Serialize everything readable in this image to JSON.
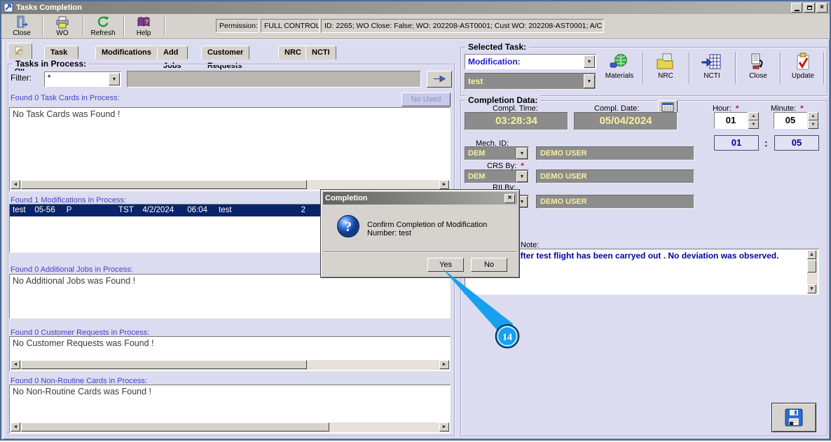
{
  "window": {
    "title": "Tasks Completion"
  },
  "toolbar": {
    "close": "Close",
    "wo": "WO",
    "refresh": "Refresh",
    "help": "Help",
    "permission_label": "Permission:",
    "permission_value": "FULL CONTROL",
    "context": "ID: 2265; WO Close: False; WO: 202208-AST0001; Cust WO: 202208-AST0001; A/C Reg:"
  },
  "tabs": [
    "All",
    "Task Cards",
    "Modifications",
    "Add Jobs",
    "Customer Requests",
    "NRC",
    "NCTI"
  ],
  "left": {
    "group_title": "Tasks in Process:",
    "filter_label": "Filter:",
    "filter_value": "*",
    "no_used_label": "No Used",
    "sections": [
      {
        "label": "Found 0 Task Cards in Process:",
        "content": "No Task Cards was Found !"
      },
      {
        "label": "Found 1 Modifications in Process:",
        "row": "test    05-56     P                     TST    4/2/2024      06:04     test                               2       1"
      },
      {
        "label": "Found 0 Additional Jobs in Process:",
        "content": "No Additional Jobs was Found !"
      },
      {
        "label": "Found 0 Customer Requests in Process:",
        "content": "No Customer Requests was Found !"
      },
      {
        "label": "Found 0 Non-Routine Cards in Process:",
        "content": "No Non-Routine Cards was Found !"
      }
    ]
  },
  "selected_task": {
    "group_title": "Selected Task:",
    "type_value": "Modification:",
    "task_value": "test",
    "buttons": [
      "Materials",
      "NRC",
      "NCTI",
      "Close",
      "Update"
    ]
  },
  "completion": {
    "group_title": "Completion Data:",
    "time_label": "Compl. Time:",
    "time_value": "03:28:34",
    "date_label": "Compl. Date:",
    "date_value": "05/04/2024",
    "hour_label": "Hour:",
    "hour_value": "01",
    "minute_label": "Minute:",
    "minute_value": "05",
    "hour_echo": "01",
    "minute_echo": "05",
    "colon": ":",
    "required_marker": "*",
    "mech_label": "Mech. ID:",
    "mech_value": "DEM",
    "mech_name": "DEMO USER",
    "crs_label": "CRS By:",
    "crs_value": "DEM",
    "crs_name": "DEMO USER",
    "rii_label": "RII By:",
    "rii_name": "DEMO USER",
    "note_label": "Note:",
    "note_text": "After test flight has been carryed out . No deviation was observed."
  },
  "dialog": {
    "title": "Completion",
    "message": "Confirm Completion of Modification Number: test",
    "yes_label": "Yes",
    "no_label": "No"
  },
  "callout": {
    "number": "14"
  },
  "icons": {
    "dropdown": "▼",
    "scroll_left": "◄",
    "scroll_right": "►",
    "scroll_up": "▲",
    "scroll_down": "▼",
    "spin_up": "▲",
    "spin_down": "▼",
    "close_x": "×"
  },
  "colors": {
    "selection_navy": "#0a246a",
    "panel_lavender": "#dcdcf0",
    "field_gray": "#8c8c8c",
    "value_yellow": "#f6f0a0",
    "label_blue": "#4343c8",
    "callout_blue": "#18a0f0",
    "note_navy": "#0000a0"
  }
}
